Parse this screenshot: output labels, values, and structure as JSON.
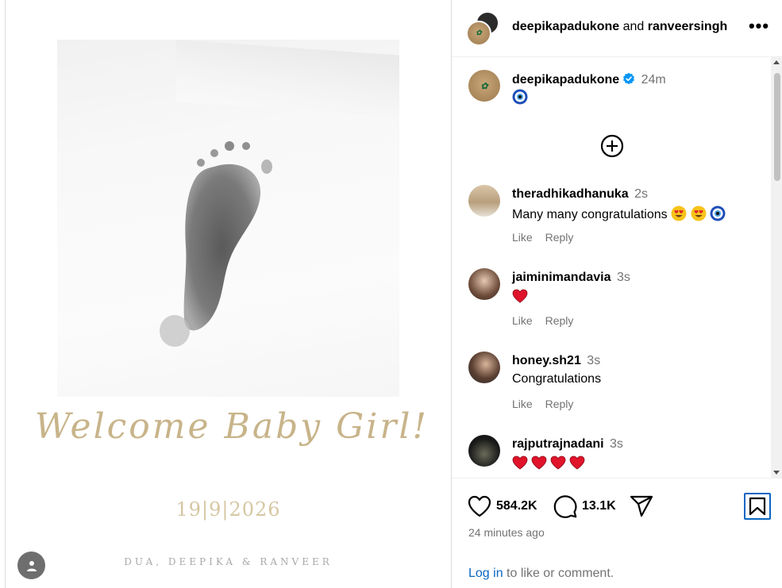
{
  "post_image": {
    "welcome_text": "Welcome Baby Girl!",
    "date_text": "19|9|2026",
    "names_text": "DUA, DEEPIKA & RANVEER"
  },
  "header": {
    "user1": "deepikapadukone",
    "joiner": "and",
    "user2": "ranveersingh",
    "more_label": "•••"
  },
  "caption": {
    "username": "deepikapadukone",
    "time": "24m",
    "text": "🧿"
  },
  "comments": [
    {
      "username": "theradhikadhanuka",
      "time": "2s",
      "text": "Many many congratulations",
      "emoji": [
        "heart-eyes",
        "heart-eyes",
        "nazar"
      ],
      "like": "Like",
      "reply": "Reply"
    },
    {
      "username": "jaiminimandavia",
      "time": "3s",
      "text": "",
      "emoji": [
        "red-heart"
      ],
      "like": "Like",
      "reply": "Reply"
    },
    {
      "username": "honey.sh21",
      "time": "3s",
      "text": "Congratulations",
      "emoji": [],
      "like": "Like",
      "reply": "Reply"
    },
    {
      "username": "rajputrajnadani",
      "time": "3s",
      "text": "",
      "emoji": [
        "red-heart",
        "red-heart",
        "red-heart",
        "red-heart"
      ]
    }
  ],
  "actions": {
    "likes": "584.2K",
    "comments": "13.1K"
  },
  "posted_time": "24 minutes ago",
  "login": {
    "link": "Log in",
    "rest": "to like or comment."
  },
  "colors": {
    "link_blue": "#0a66c2",
    "gold": "#c8b48a",
    "muted": "#737373",
    "verified": "#0095f6"
  }
}
